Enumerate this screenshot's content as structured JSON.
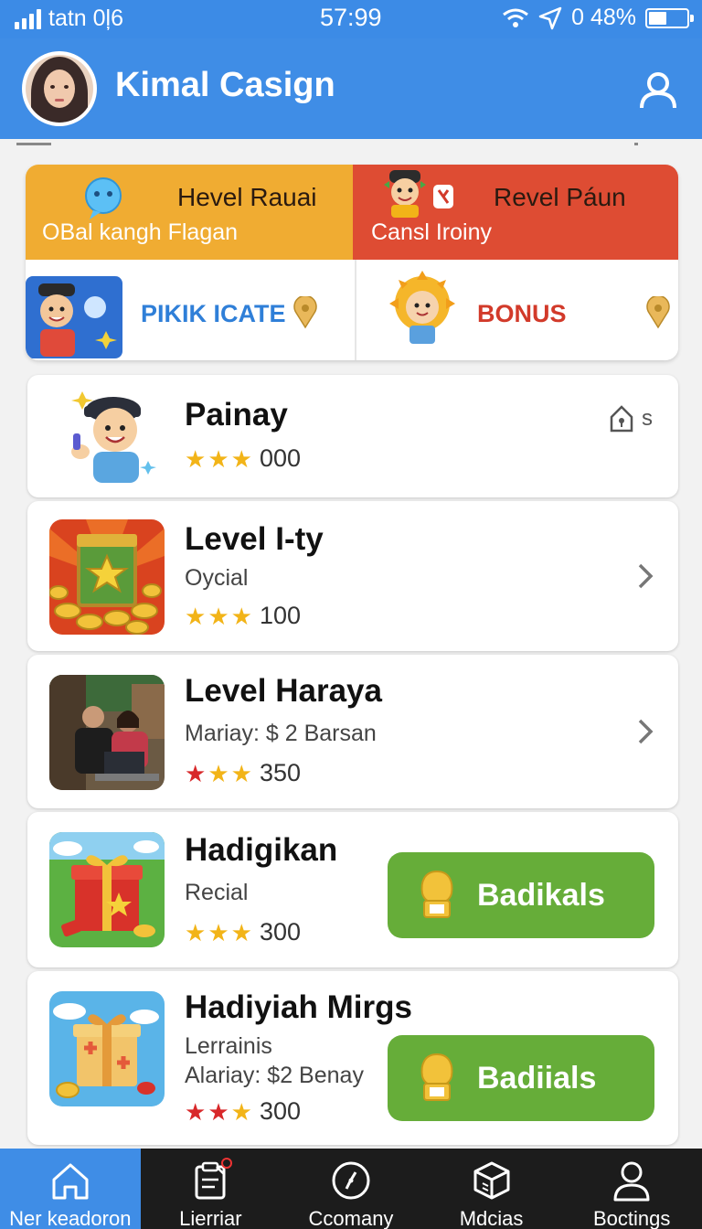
{
  "status_bar": {
    "carrier": "tatn 0ļ6",
    "time": "57:99",
    "battery_text": "0 48%",
    "battery_level": 0.48
  },
  "header": {
    "title": "Kimal Casign",
    "avatar_icon": "avatar-woman-hijab",
    "profile_icon": "user-icon"
  },
  "promos": [
    {
      "title": "Hevel Rauai",
      "subtitle": "OBal kangh Flagan",
      "label": "PIKIK ICATE",
      "color": "#f0ac32",
      "label_color": "#2f7fd8",
      "icon": "chat-bubble-icon"
    },
    {
      "title": "Revel Páun",
      "subtitle": "Cansl Iroiny",
      "label": "BONUS",
      "color": "#de4c33",
      "label_color": "#d23a2a",
      "icon": "gift-tag-icon"
    }
  ],
  "items": [
    {
      "title": "Painay",
      "subtitle": "",
      "stars": [
        "gold",
        "gold",
        "gold"
      ],
      "rating": "000",
      "action": "badge",
      "badge_text": "s",
      "thumb": "boy-cartoon"
    },
    {
      "title": "Level I-ty",
      "subtitle": "Oycial",
      "stars": [
        "gold",
        "gold",
        "gold"
      ],
      "rating": "100",
      "action": "chevron",
      "thumb": "treasure-chest"
    },
    {
      "title": "Level Haraya",
      "subtitle": "Mariay: $ 2 Barsan",
      "stars": [
        "red",
        "gold",
        "gold"
      ],
      "rating": "350",
      "action": "chevron",
      "thumb": "people-laptop-photo"
    },
    {
      "title": "Hadigikan",
      "subtitle": "Recial",
      "stars": [
        "gold",
        "gold",
        "gold"
      ],
      "rating": "300",
      "action": "button",
      "button_label": "Badikals",
      "thumb": "gift-box-red"
    },
    {
      "title": "Hadiyiah Mirgs",
      "subtitle": "Lerrainis",
      "subtitle2": "Alariay: $2 Benay",
      "stars": [
        "red",
        "red",
        "gold"
      ],
      "rating": "300",
      "action": "button",
      "button_label": "Badiials",
      "thumb": "gift-box-gold"
    }
  ],
  "tabs": [
    {
      "label": "Ner keadoron",
      "icon": "home-icon",
      "active": true
    },
    {
      "label": "Lierriar",
      "icon": "clipboard-icon",
      "active": false,
      "badge": true
    },
    {
      "label": "Ccomany",
      "icon": "compass-icon",
      "active": false
    },
    {
      "label": "Mdcias",
      "icon": "box-icon",
      "active": false
    },
    {
      "label": "Boctings",
      "icon": "person-icon",
      "active": false
    }
  ],
  "colors": {
    "primary": "#3f8de6",
    "green_button": "#66ad39",
    "star_gold": "#f2b418",
    "star_red": "#d8282a",
    "tabbar": "#1c1c1c"
  }
}
